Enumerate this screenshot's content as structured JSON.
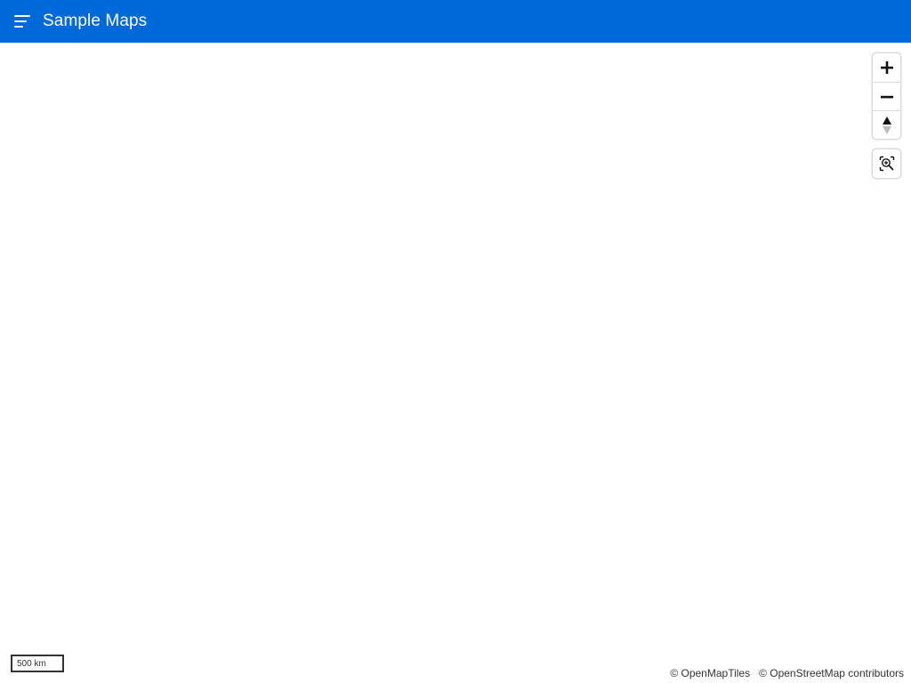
{
  "header": {
    "menu_icon": "menu-icon",
    "title": "Sample Maps",
    "background_color": "#0069d9"
  },
  "map": {
    "controls": {
      "zoom_in_icon": "plus-icon",
      "zoom_out_icon": "minus-icon",
      "compass_icon": "compass-icon",
      "zoom_to_fit_icon": "zoom-to-fit-icon"
    },
    "scale_label": "500 km",
    "attribution": [
      "© OpenMapTiles",
      "© OpenStreetMap contributors"
    ]
  }
}
